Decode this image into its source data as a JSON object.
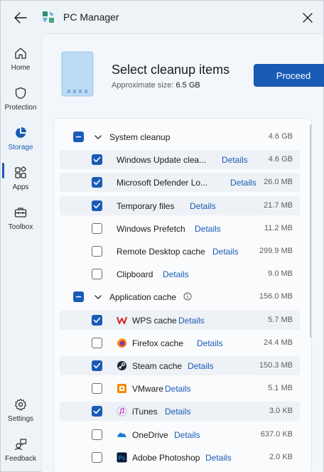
{
  "window": {
    "title": "PC Manager"
  },
  "nav": {
    "items": [
      {
        "label": "Home",
        "icon": "home-icon"
      },
      {
        "label": "Protection",
        "icon": "shield-icon"
      },
      {
        "label": "Storage",
        "icon": "pie-chart-icon",
        "active": true
      },
      {
        "label": "Apps",
        "icon": "apps-icon"
      },
      {
        "label": "Toolbox",
        "icon": "toolbox-icon"
      },
      {
        "label": "Settings",
        "icon": "gear-icon"
      },
      {
        "label": "Feedback",
        "icon": "feedback-icon"
      }
    ]
  },
  "header": {
    "title": "Select cleanup items",
    "size_prefix": "Approximate size:",
    "size_value": "6.5 GB",
    "proceed_label": "Proceed"
  },
  "groups": [
    {
      "label": "System cleanup",
      "size": "4.6 GB",
      "state": "partial",
      "items": [
        {
          "label": "Windows Update clea...",
          "details": "Details",
          "size": "4.6 GB",
          "checked": true
        },
        {
          "label": "Microsoft Defender Lo...",
          "details": "Details",
          "size": "26.0 MB",
          "checked": true
        },
        {
          "label": "Temporary files",
          "details": "Details",
          "size": "21.7 MB",
          "checked": true
        },
        {
          "label": "Windows Prefetch",
          "details": "Details",
          "size": "11.2 MB",
          "checked": false
        },
        {
          "label": "Remote Desktop cache",
          "details": "Details",
          "size": "299.9 MB",
          "checked": false
        },
        {
          "label": "Clipboard",
          "details": "Details",
          "size": "9.0 MB",
          "checked": false
        }
      ]
    },
    {
      "label": "Application cache",
      "size": "156.0 MB",
      "state": "partial",
      "items": [
        {
          "label": "WPS cache",
          "details": "Details",
          "size": "5.7 MB",
          "checked": true,
          "icon": "wps-icon"
        },
        {
          "label": "Firefox cache",
          "details": "Details",
          "size": "24.4 MB",
          "checked": false,
          "icon": "firefox-icon"
        },
        {
          "label": "Steam cache",
          "details": "Details",
          "size": "150.3 MB",
          "checked": true,
          "icon": "steam-icon"
        },
        {
          "label": "VMware",
          "details": "Details",
          "size": "5.1 MB",
          "checked": false,
          "icon": "vmware-icon"
        },
        {
          "label": "iTunes",
          "details": "Details",
          "size": "3.0 KB",
          "checked": true,
          "icon": "itunes-icon"
        },
        {
          "label": "OneDrive",
          "details": "Details",
          "size": "637.0 KB",
          "checked": false,
          "icon": "onedrive-icon"
        },
        {
          "label": "Adobe Photoshop",
          "details": "Details",
          "size": "2.0 KB",
          "checked": false,
          "icon": "photoshop-icon"
        }
      ]
    }
  ],
  "colors": {
    "accent": "#1a5bb6",
    "link": "#1a5bb6"
  }
}
